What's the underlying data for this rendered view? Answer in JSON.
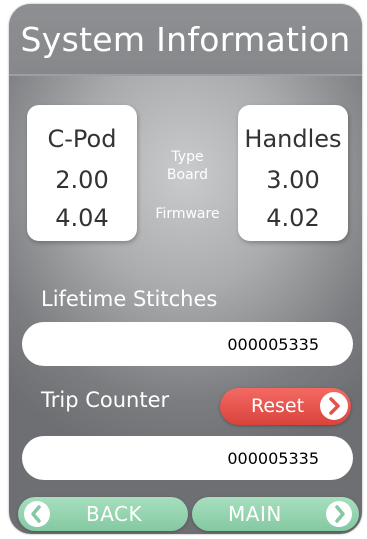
{
  "title": "System Information",
  "columns": {
    "left": {
      "name": "C-Pod",
      "board": "2.00",
      "firmware": "4.04"
    },
    "labels": {
      "type": "Type",
      "board": "Board",
      "firmware": "Firmware"
    },
    "right": {
      "name": "Handles",
      "board": "3.00",
      "firmware": "4.02"
    }
  },
  "lifetime": {
    "label": "Lifetime Stitches",
    "value": "000005335"
  },
  "trip": {
    "label": "Trip Counter",
    "value": "000005335",
    "reset_label": "Reset"
  },
  "nav": {
    "back_label": "BACK",
    "main_label": "MAIN"
  },
  "icons": {
    "reset": "chevron-right-icon",
    "back": "chevron-left-icon",
    "main": "chevron-right-icon"
  },
  "colors": {
    "reset_red": "#e2524b",
    "nav_green": "#96d4b1",
    "background_gray": "#a9abad"
  }
}
